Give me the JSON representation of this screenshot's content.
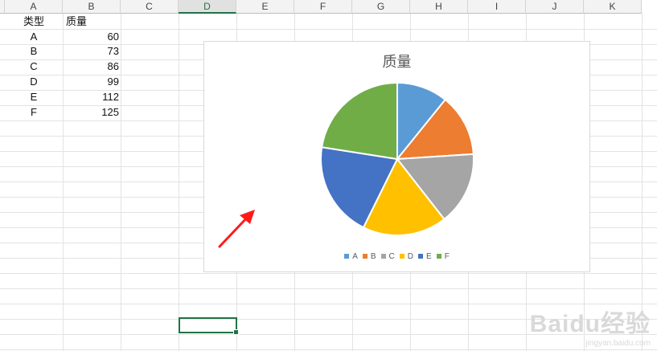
{
  "columns": [
    "A",
    "B",
    "C",
    "D",
    "E",
    "F",
    "G",
    "H",
    "I",
    "J",
    "K"
  ],
  "selected_column": "D",
  "table": {
    "headers": [
      "类型",
      "质量"
    ],
    "rows": [
      {
        "type": "A",
        "value": "60"
      },
      {
        "type": "B",
        "value": "73"
      },
      {
        "type": "C",
        "value": "86"
      },
      {
        "type": "D",
        "value": "99"
      },
      {
        "type": "E",
        "value": "112"
      },
      {
        "type": "F",
        "value": "125"
      }
    ]
  },
  "chart_data": {
    "type": "pie",
    "title": "质量",
    "categories": [
      "A",
      "B",
      "C",
      "D",
      "E",
      "F"
    ],
    "values": [
      60,
      73,
      86,
      99,
      112,
      125
    ],
    "colors": [
      "#5b9bd5",
      "#ed7d31",
      "#a5a5a5",
      "#ffc000",
      "#4472c4",
      "#70ad47"
    ],
    "legend": "bottom"
  },
  "annotation": {
    "arrow_color": "#ff0000",
    "icon": "red-arrow-icon"
  },
  "watermark": {
    "line1": "Bai",
    "line1_b": "du",
    "line1_c": "经验",
    "line2": "jingyan.baidu.com"
  }
}
